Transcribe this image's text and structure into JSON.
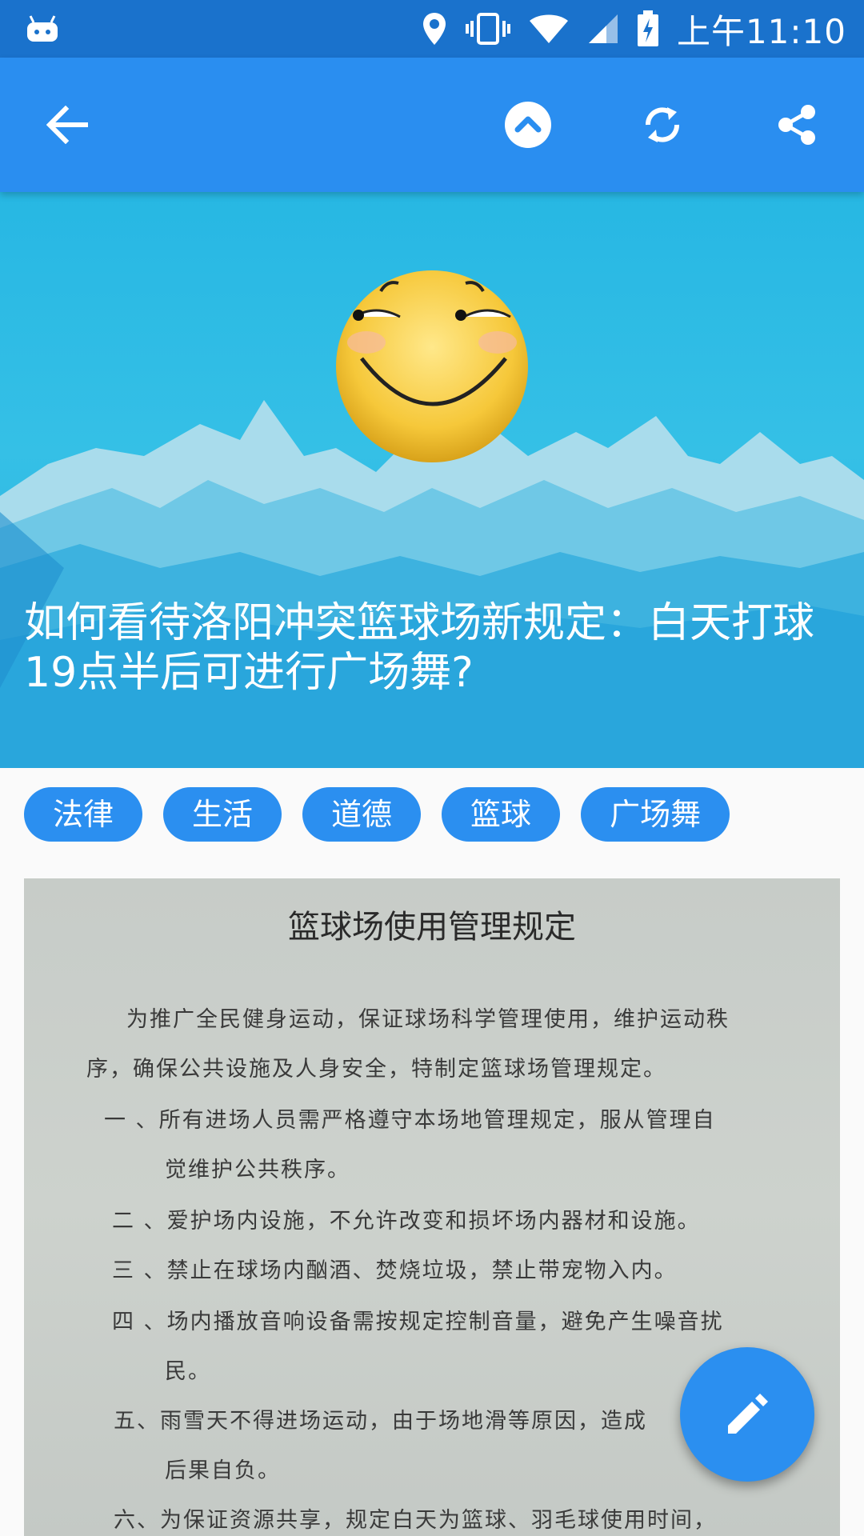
{
  "status_bar": {
    "time": "上午11:10",
    "icons": [
      "android-debug-icon",
      "location-icon",
      "vibrate-icon",
      "wifi-icon",
      "signal-icon",
      "battery-charging-icon"
    ]
  },
  "toolbar": {
    "icons": [
      "back-arrow-icon",
      "scroll-top-icon",
      "refresh-icon",
      "share-icon"
    ],
    "color": "#2a8ef0"
  },
  "hero": {
    "title": "如何看待洛阳冲突篮球场新规定：白天打球 19点半后可进行广场舞?"
  },
  "tags": [
    "法律",
    "生活",
    "道德",
    "篮球",
    "广场舞"
  ],
  "document": {
    "title": "篮球场使用管理规定",
    "lines": [
      "为推广全民健身运动，保证球场科学管理使用，维护运动秩",
      "序，确保公共设施及人身安全，特制定篮球场管理规定。",
      "一 、所有进场人员需严格遵守本场地管理规定，服从管理自",
      "觉维护公共秩序。",
      "二 、爱护场内设施，不允许改变和损坏场内器材和设施。",
      "三 、禁止在球场内酗酒、焚烧垃圾，禁止带宠物入内。",
      "四 、场内播放音响设备需按规定控制音量，避免产生噪音扰",
      "民。",
      "五、雨雪天不得进场运动，由于场地滑等原因，造成",
      "后果自负。",
      "六、为保证资源共享，规定白天为篮球、羽毛球使用时间，"
    ]
  },
  "fab": {
    "icon": "edit-pencil-icon"
  },
  "colors": {
    "accent": "#2b8ff0",
    "status_bar": "#1a72cc"
  }
}
